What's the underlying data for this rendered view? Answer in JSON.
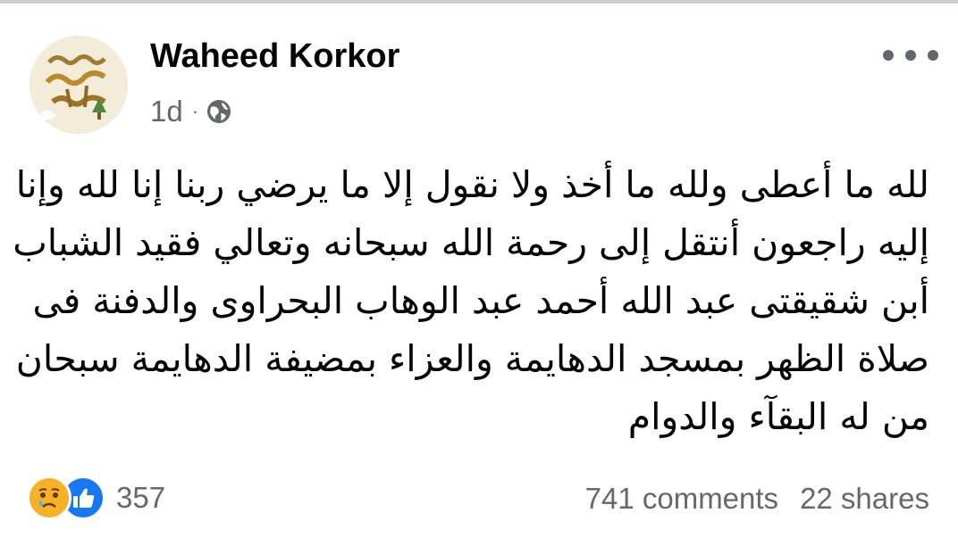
{
  "post": {
    "author": "Waheed Korkor",
    "timestamp": "1d",
    "separator": "·",
    "privacy_icon": "globe-icon",
    "more_icon": "ellipsis-icon",
    "avatar_icon": "profile-picture-calligraphy",
    "body_lines": [
      "لله ما أعطى ولله ما أخذ ولا نقول إلا ما يرضي ربنا إنا لله وإنا",
      "إليه راجعون أنتقل إلى رحمة الله سبحانه وتعالي فقيد الشباب",
      "أبن شقيقتى عبد الله أحمد عبد الوهاب البحراوى والدفنة فى",
      "صلاة الظهر بمسجد الدهايمة والعزاء  بمضيفة الدهايمة سبحان",
      "من له البقآء والدوام"
    ]
  },
  "footer": {
    "reaction_icons": [
      "sad-reaction-icon",
      "like-reaction-icon"
    ],
    "reaction_count": "357",
    "comments": "741 comments",
    "shares": "22 shares"
  },
  "colors": {
    "text_primary": "#050505",
    "text_secondary": "#65676b",
    "like_blue": "#1877f2",
    "sad_yellow": "#f7b125",
    "divider": "#ccd0d5"
  }
}
